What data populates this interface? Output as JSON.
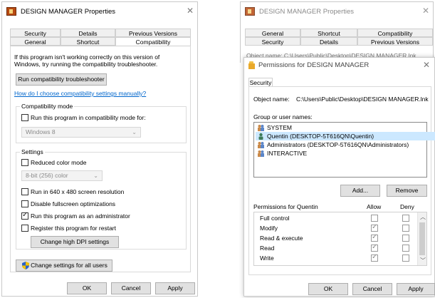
{
  "left_dialog": {
    "title": "DESIGN MANAGER Properties",
    "tabs_row1": [
      "Security",
      "Details",
      "Previous Versions"
    ],
    "tabs_row2": [
      "General",
      "Shortcut",
      "Compatibility"
    ],
    "intro": "If this program isn't working correctly on this version of Windows, try running the compatibility troubleshooter.",
    "troubleshooter_button": "Run compatibility troubleshooter",
    "help_link": "How do I choose compatibility settings manually?",
    "compat_mode": {
      "legend": "Compatibility mode",
      "checkbox_label": "Run this program in compatibility mode for:",
      "checked": false,
      "selected_os": "Windows 8"
    },
    "settings": {
      "legend": "Settings",
      "reduced_color": {
        "label": "Reduced color mode",
        "checked": false
      },
      "color_select": "8-bit (256) color",
      "res_640": {
        "label": "Run in 640 x 480 screen resolution",
        "checked": false
      },
      "disable_fullscreen": {
        "label": "Disable fullscreen optimizations",
        "checked": false
      },
      "run_as_admin": {
        "label": "Run this program as an administrator",
        "checked": true
      },
      "register_restart": {
        "label": "Register this program for restart",
        "checked": false
      },
      "dpi_button": "Change high DPI settings"
    },
    "all_users_button": "Change settings for all users",
    "ok": "OK",
    "cancel": "Cancel",
    "apply": "Apply"
  },
  "right_back_dialog": {
    "title": "DESIGN MANAGER Properties",
    "tabs_row1": [
      "General",
      "Shortcut",
      "Compatibility"
    ],
    "tabs_row2": [
      "Security",
      "Details",
      "Previous Versions"
    ],
    "peek_text": "Object name:   C:\\Users\\Public\\Desktop\\DESIGN MANAGER.lnk"
  },
  "permissions_dialog": {
    "title": "Permissions for DESIGN MANAGER",
    "tab": "Security",
    "object_label": "Object name:",
    "object_value": "C:\\Users\\Public\\Desktop\\DESIGN MANAGER.lnk",
    "group_label": "Group or user names:",
    "users": [
      {
        "name": "SYSTEM",
        "icon": "group-icon",
        "selected": false
      },
      {
        "name": "Quentin (DESKTOP-5T616QN\\Quentin)",
        "icon": "user-icon",
        "selected": true
      },
      {
        "name": "Administrators (DESKTOP-5T616QN\\Administrators)",
        "icon": "group-icon",
        "selected": false
      },
      {
        "name": "INTERACTIVE",
        "icon": "group-icon",
        "selected": false
      }
    ],
    "add_button": "Add...",
    "remove_button": "Remove",
    "perm_header": "Permissions for Quentin",
    "allow_header": "Allow",
    "deny_header": "Deny",
    "permissions": [
      {
        "name": "Full control",
        "allow": false,
        "deny": false
      },
      {
        "name": "Modify",
        "allow": true,
        "deny": false
      },
      {
        "name": "Read & execute",
        "allow": true,
        "deny": false
      },
      {
        "name": "Read",
        "allow": true,
        "deny": false
      },
      {
        "name": "Write",
        "allow": true,
        "deny": false
      }
    ],
    "ok": "OK",
    "cancel": "Cancel",
    "apply": "Apply"
  },
  "colors": {
    "accent_link": "#0066cc",
    "selection": "#cce8ff",
    "app_icon": "#b84a12"
  }
}
